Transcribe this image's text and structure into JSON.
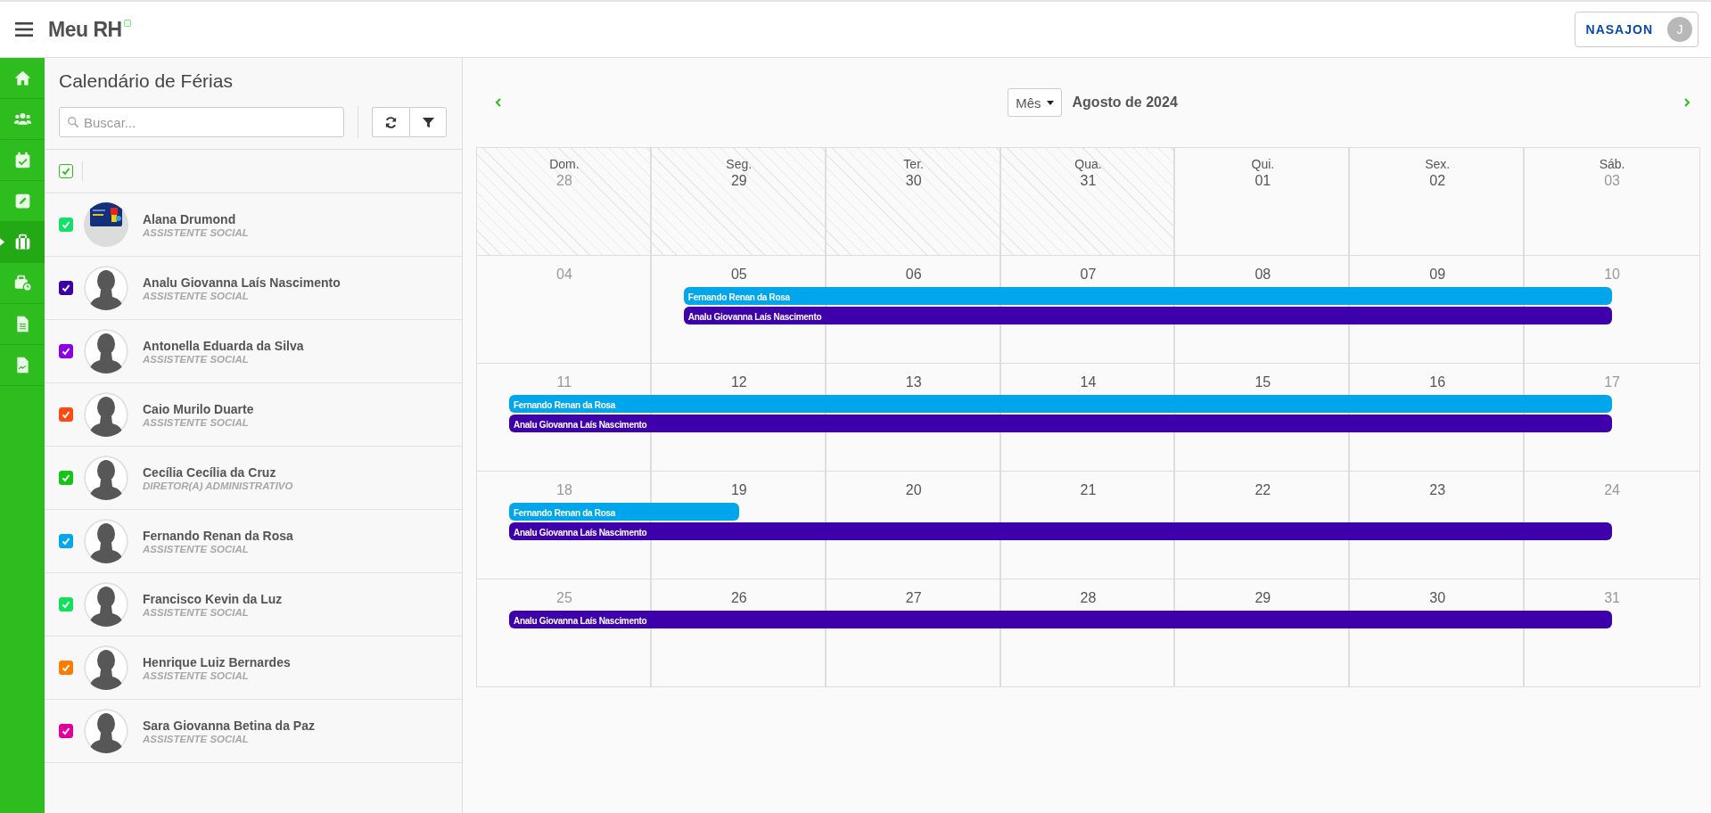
{
  "header": {
    "app_name": "Meu RH",
    "brand": "NASAJON",
    "user_initial": "J"
  },
  "sidebar": {
    "items": [
      {
        "kind": "home",
        "selected": false
      },
      {
        "kind": "users",
        "selected": false
      },
      {
        "kind": "calendar",
        "selected": false
      },
      {
        "kind": "edit",
        "selected": false
      },
      {
        "kind": "briefcase",
        "selected": true
      },
      {
        "kind": "briefcase-clock",
        "selected": false
      },
      {
        "kind": "file",
        "selected": false
      },
      {
        "kind": "file-chart",
        "selected": false
      }
    ]
  },
  "panel": {
    "title": "Calendário de Férias",
    "search": {
      "placeholder": "Buscar..."
    },
    "select_all": {
      "checked": true
    },
    "employees": [
      {
        "name": "Alana Drumond",
        "role": "ASSISTENTE SOCIAL",
        "checked": true,
        "color": "#12e06a"
      },
      {
        "name": "Analu Giovanna Laís Nascimento",
        "role": "ASSISTENTE SOCIAL",
        "checked": true,
        "color": "#3b00a8",
        "kind": "silhouette"
      },
      {
        "name": "Antonella Eduarda da Silva",
        "role": "ASSISTENTE SOCIAL",
        "checked": true,
        "color": "#8a00e0",
        "kind": "silhouette"
      },
      {
        "name": "Caio Murilo Duarte",
        "role": "ASSISTENTE SOCIAL",
        "checked": true,
        "color": "#ff4a10",
        "kind": "silhouette"
      },
      {
        "name": "Cecília Cecília da Cruz",
        "role": "DIRETOR(A) ADMINISTRATIVO",
        "checked": true,
        "color": "#16c416",
        "kind": "silhouette"
      },
      {
        "name": "Fernando Renan da Rosa",
        "role": "ASSISTENTE SOCIAL",
        "checked": true,
        "color": "#00a6ee",
        "kind": "silhouette"
      },
      {
        "name": "Francisco Kevin da Luz",
        "role": "ASSISTENTE SOCIAL",
        "checked": true,
        "color": "#12e05a",
        "kind": "silhouette"
      },
      {
        "name": "Henrique Luiz Bernardes",
        "role": "ASSISTENTE SOCIAL",
        "checked": true,
        "color": "#ff7a00",
        "kind": "silhouette"
      },
      {
        "name": "Sara Giovanna Betina da Paz",
        "role": "ASSISTENTE SOCIAL",
        "checked": true,
        "color": "#e0009b",
        "kind": "silhouette"
      }
    ]
  },
  "calendar": {
    "view": "Mês",
    "title": "Agosto de 2024",
    "weekdays": [
      "Dom.",
      "Seg.",
      "Ter.",
      "Qua.",
      "Qui.",
      "Sex.",
      "Sáb."
    ],
    "weeks": [
      {
        "days": [
          {
            "day": "28",
            "muted": true,
            "outside": true
          },
          {
            "day": "29",
            "muted": false,
            "outside": true
          },
          {
            "day": "30",
            "muted": false,
            "outside": true
          },
          {
            "day": "31",
            "muted": false,
            "outside": true
          },
          {
            "day": "01",
            "muted": false,
            "outside": false
          },
          {
            "day": "02",
            "muted": false,
            "outside": false
          },
          {
            "day": "03",
            "muted": true,
            "outside": false
          }
        ]
      },
      {
        "days": [
          {
            "day": "04",
            "muted": true,
            "outside": false
          },
          {
            "day": "05",
            "muted": false,
            "outside": false
          },
          {
            "day": "06",
            "muted": false,
            "outside": false
          },
          {
            "day": "07",
            "muted": false,
            "outside": false
          },
          {
            "day": "08",
            "muted": false,
            "outside": false
          },
          {
            "day": "09",
            "muted": false,
            "outside": false
          },
          {
            "day": "10",
            "muted": true,
            "outside": false
          }
        ],
        "events": [
          {
            "name": "Fernando Renan da Rosa",
            "color": "#00a6eb",
            "covers": [
              false,
              true,
              true,
              true,
              true,
              true,
              true
            ]
          },
          {
            "name": "Analu Giovanna Laís Nascimento",
            "color": "#3d00aa",
            "covers": [
              false,
              true,
              true,
              true,
              true,
              true,
              true
            ]
          }
        ]
      },
      {
        "days": [
          {
            "day": "11",
            "muted": true,
            "outside": false
          },
          {
            "day": "12",
            "muted": false,
            "outside": false
          },
          {
            "day": "13",
            "muted": false,
            "outside": false
          },
          {
            "day": "14",
            "muted": false,
            "outside": false
          },
          {
            "day": "15",
            "muted": false,
            "outside": false
          },
          {
            "day": "16",
            "muted": false,
            "outside": false
          },
          {
            "day": "17",
            "muted": true,
            "outside": false
          }
        ],
        "events": [
          {
            "name": "Fernando Renan da Rosa",
            "color": "#00a6eb",
            "covers": [
              true,
              true,
              true,
              true,
              true,
              true,
              true
            ]
          },
          {
            "name": "Analu Giovanna Laís Nascimento",
            "color": "#3d00aa",
            "covers": [
              true,
              true,
              true,
              true,
              true,
              true,
              true
            ]
          }
        ]
      },
      {
        "days": [
          {
            "day": "18",
            "muted": true,
            "outside": false
          },
          {
            "day": "19",
            "muted": false,
            "outside": false
          },
          {
            "day": "20",
            "muted": false,
            "outside": false
          },
          {
            "day": "21",
            "muted": false,
            "outside": false
          },
          {
            "day": "22",
            "muted": false,
            "outside": false
          },
          {
            "day": "23",
            "muted": false,
            "outside": false
          },
          {
            "day": "24",
            "muted": true,
            "outside": false
          }
        ],
        "events": [
          {
            "name": "Fernando Renan da Rosa",
            "color": "#00a6eb",
            "covers": [
              true,
              true,
              false,
              false,
              false,
              false,
              false
            ]
          },
          {
            "name": "Analu Giovanna Laís Nascimento",
            "color": "#3d00aa",
            "covers": [
              true,
              true,
              true,
              true,
              true,
              true,
              true
            ]
          }
        ]
      },
      {
        "days": [
          {
            "day": "25",
            "muted": true,
            "outside": false
          },
          {
            "day": "26",
            "muted": false,
            "outside": false
          },
          {
            "day": "27",
            "muted": false,
            "outside": false
          },
          {
            "day": "28",
            "muted": false,
            "outside": false
          },
          {
            "day": "29",
            "muted": false,
            "outside": false
          },
          {
            "day": "30",
            "muted": false,
            "outside": false
          },
          {
            "day": "31",
            "muted": true,
            "outside": false
          }
        ],
        "events": [
          {
            "name": "Analu Giovanna Laís Nascimento",
            "color": "#3d00aa",
            "covers": [
              true,
              true,
              true,
              true,
              true,
              true,
              true
            ]
          }
        ]
      }
    ]
  }
}
